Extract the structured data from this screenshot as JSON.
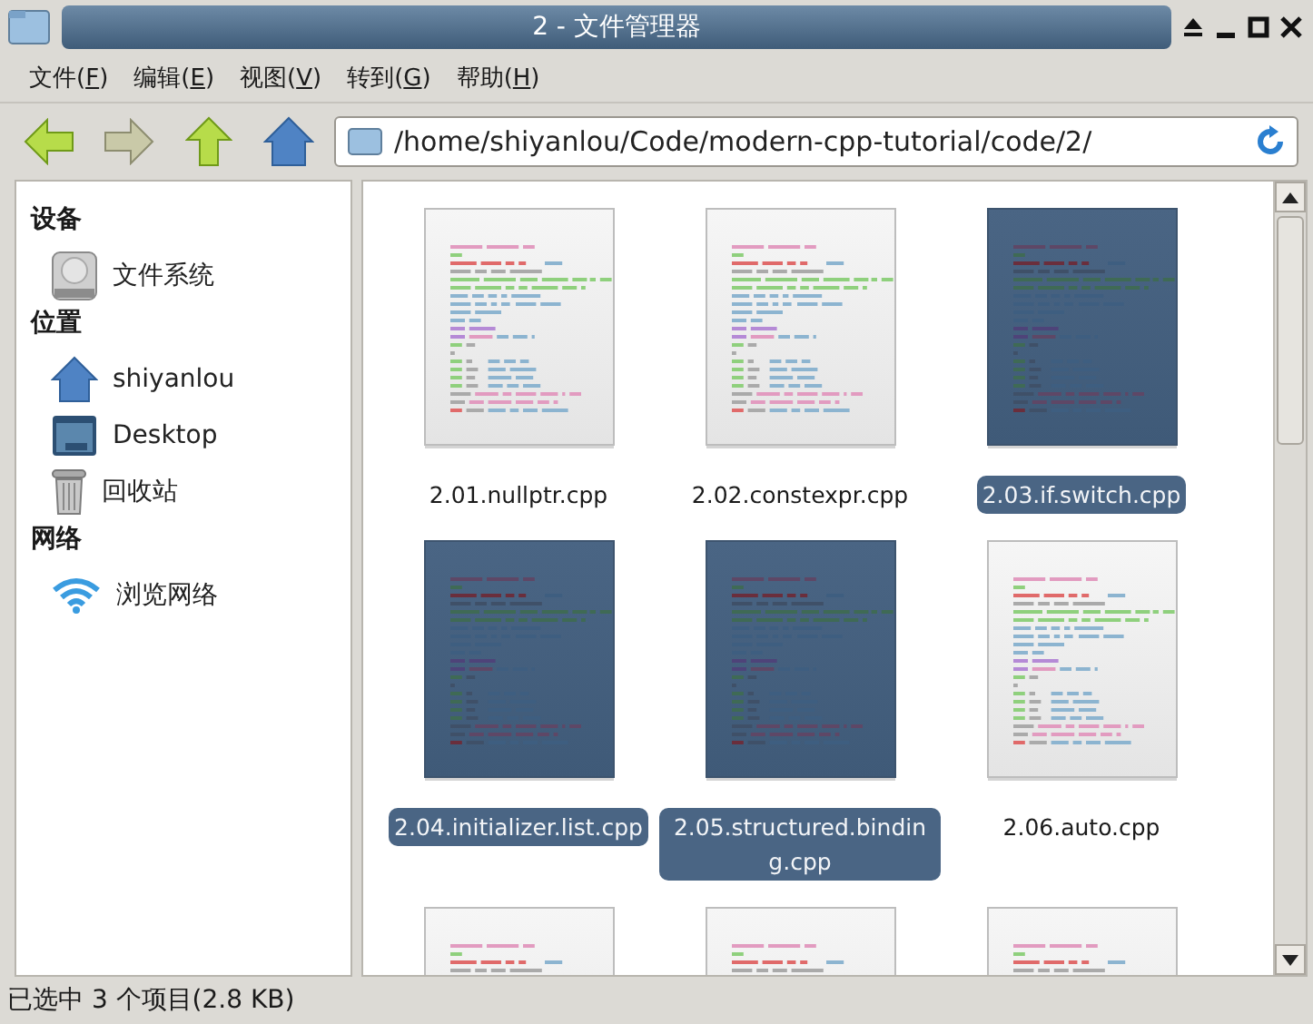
{
  "window": {
    "title": "2 - 文件管理器"
  },
  "menu": [
    {
      "before": "文件(",
      "key": "F",
      "after": ")"
    },
    {
      "before": "编辑(",
      "key": "E",
      "after": ")"
    },
    {
      "before": "视图(",
      "key": "V",
      "after": ")"
    },
    {
      "before": "转到(",
      "key": "G",
      "after": ")"
    },
    {
      "before": "帮助(",
      "key": "H",
      "after": ")"
    }
  ],
  "toolbar": {
    "back_disabled": false,
    "forward_disabled": true
  },
  "address": {
    "value": "/home/shiyanlou/Code/modern-cpp-tutorial/code/2/"
  },
  "sidebar": [
    {
      "heading": "设备",
      "items": [
        {
          "kind": "drive",
          "label": "文件系统"
        }
      ]
    },
    {
      "heading": "位置",
      "items": [
        {
          "kind": "home",
          "label": "shiyanlou"
        },
        {
          "kind": "desktop",
          "label": "Desktop"
        },
        {
          "kind": "trash",
          "label": "回收站"
        }
      ]
    },
    {
      "heading": "网络",
      "items": [
        {
          "kind": "network",
          "label": "浏览网络"
        }
      ]
    }
  ],
  "files": [
    {
      "name": "2.01.nullptr.cpp",
      "selected": false
    },
    {
      "name": "2.02.constexpr.cpp",
      "selected": false
    },
    {
      "name": "2.03.if.switch.cpp",
      "selected": true
    },
    {
      "name": "2.04.initializer.list.cpp",
      "selected": true
    },
    {
      "name": "2.05.structured.binding.cpp",
      "selected": true
    },
    {
      "name": "2.06.auto.cpp",
      "selected": false
    },
    {
      "selected": false
    },
    {
      "selected": false
    },
    {
      "selected": false
    }
  ],
  "status_bar": "已选中 3 个项目(2.8 KB)"
}
